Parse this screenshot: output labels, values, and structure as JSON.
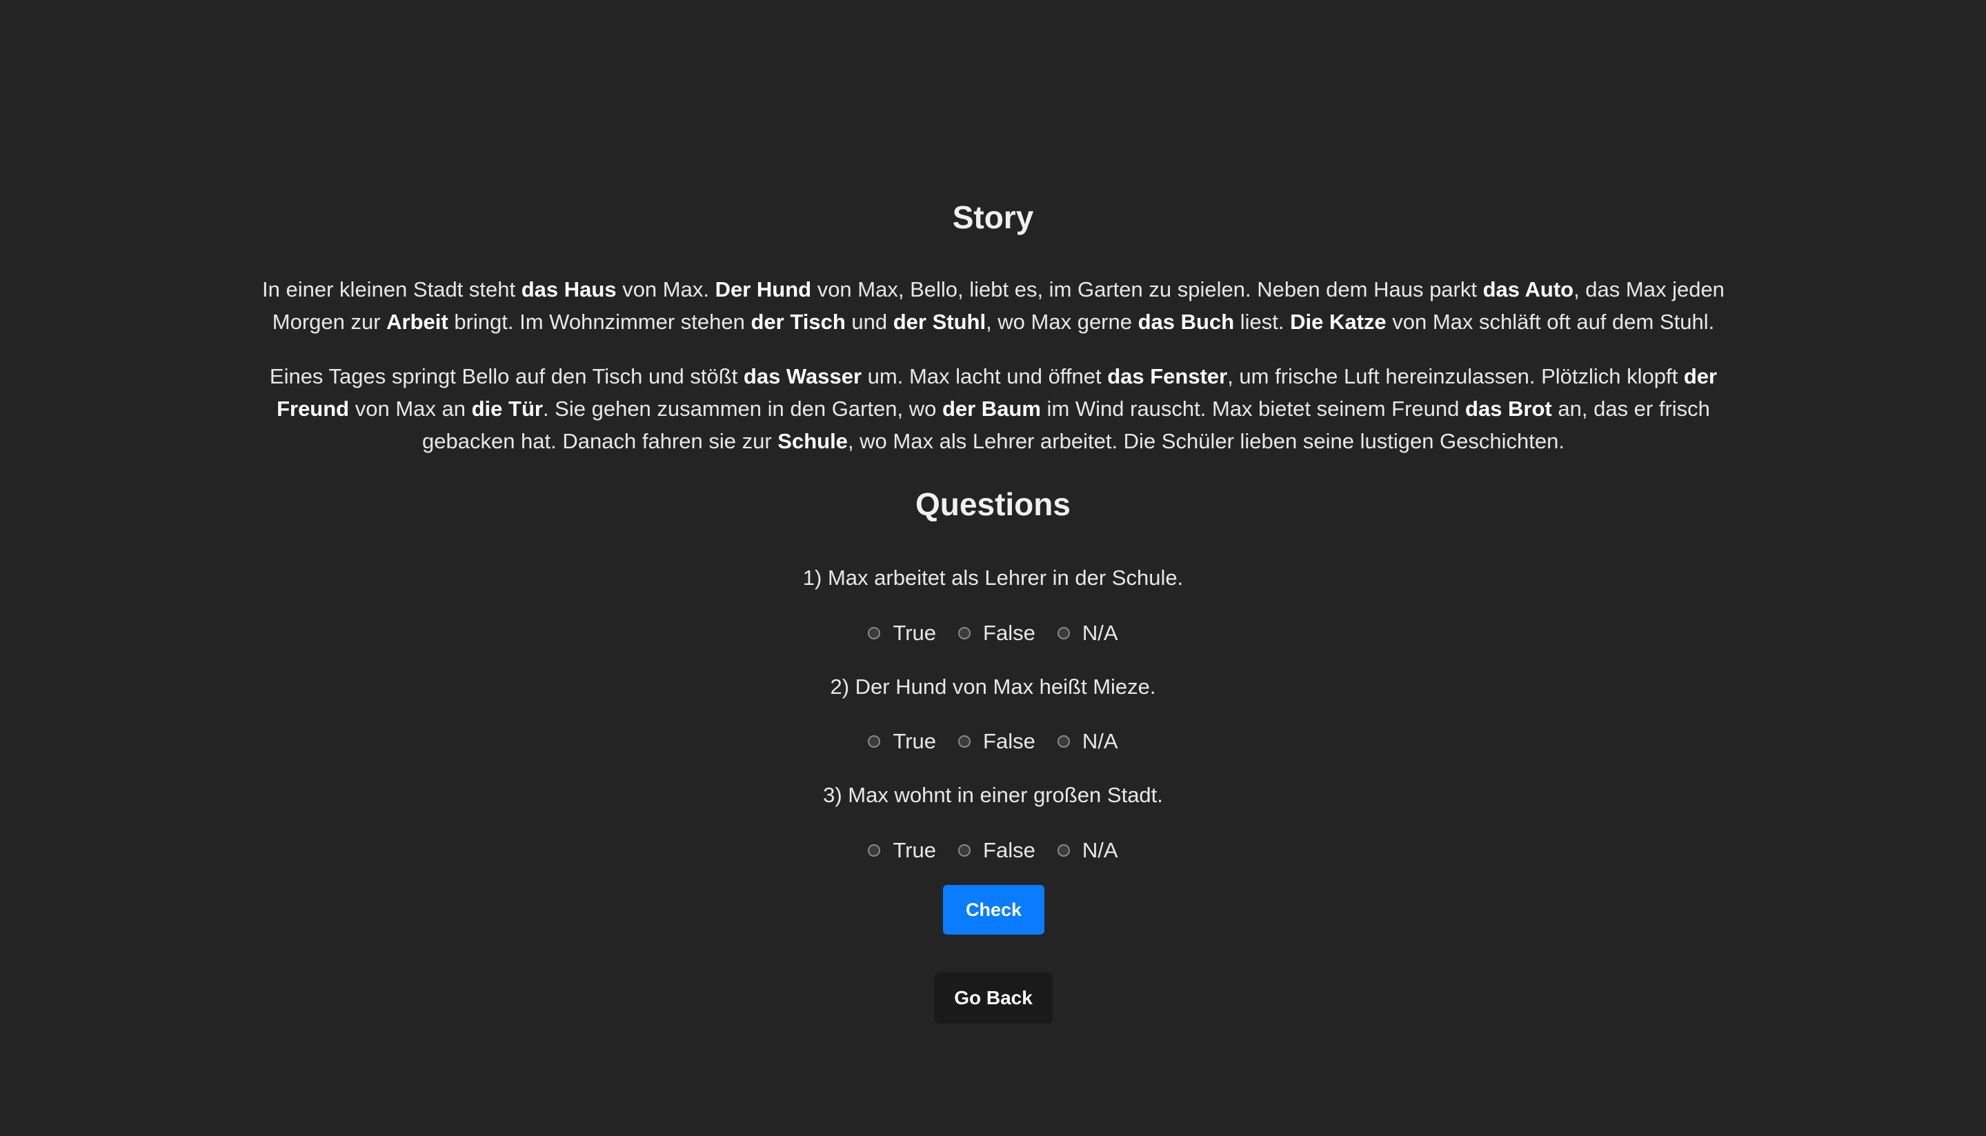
{
  "story": {
    "title": "Story",
    "paragraphs": [
      [
        {
          "t": "In einer kleinen Stadt steht ",
          "b": false
        },
        {
          "t": "das Haus",
          "b": true
        },
        {
          "t": " von Max. ",
          "b": false
        },
        {
          "t": "Der Hund",
          "b": true
        },
        {
          "t": " von Max, Bello, liebt es, im Garten zu spielen. Neben dem Haus parkt ",
          "b": false
        },
        {
          "t": "das Auto",
          "b": true
        },
        {
          "t": ", das Max jeden Morgen zur ",
          "b": false
        },
        {
          "t": "Arbeit",
          "b": true
        },
        {
          "t": " bringt. Im Wohnzimmer stehen ",
          "b": false
        },
        {
          "t": "der Tisch",
          "b": true
        },
        {
          "t": " und ",
          "b": false
        },
        {
          "t": "der Stuhl",
          "b": true
        },
        {
          "t": ", wo Max gerne ",
          "b": false
        },
        {
          "t": "das Buch",
          "b": true
        },
        {
          "t": " liest. ",
          "b": false
        },
        {
          "t": "Die Katze",
          "b": true
        },
        {
          "t": " von Max schläft oft auf dem Stuhl.",
          "b": false
        }
      ],
      [
        {
          "t": "Eines Tages springt Bello auf den Tisch und stößt ",
          "b": false
        },
        {
          "t": "das Wasser",
          "b": true
        },
        {
          "t": " um. Max lacht und öffnet ",
          "b": false
        },
        {
          "t": "das Fenster",
          "b": true
        },
        {
          "t": ", um frische Luft hereinzulassen. Plötzlich klopft ",
          "b": false
        },
        {
          "t": "der Freund",
          "b": true
        },
        {
          "t": " von Max an ",
          "b": false
        },
        {
          "t": "die Tür",
          "b": true
        },
        {
          "t": ". Sie gehen zusammen in den Garten, wo ",
          "b": false
        },
        {
          "t": "der Baum",
          "b": true
        },
        {
          "t": " im Wind rauscht. Max bietet seinem Freund ",
          "b": false
        },
        {
          "t": "das Brot",
          "b": true
        },
        {
          "t": " an, das er frisch gebacken hat. Danach fahren sie zur ",
          "b": false
        },
        {
          "t": "Schule",
          "b": true
        },
        {
          "t": ", wo Max als Lehrer arbeitet. Die Schüler lieben seine lustigen Geschichten.",
          "b": false
        }
      ]
    ]
  },
  "questions": {
    "title": "Questions",
    "items": [
      {
        "text": "1) Max arbeitet als Lehrer in der Schule.",
        "options": [
          "True",
          "False",
          "N/A"
        ]
      },
      {
        "text": "2) Der Hund von Max heißt Mieze.",
        "options": [
          "True",
          "False",
          "N/A"
        ]
      },
      {
        "text": "3) Max wohnt in einer großen Stadt.",
        "options": [
          "True",
          "False",
          "N/A"
        ]
      }
    ]
  },
  "buttons": {
    "check_label": "Check",
    "back_label": "Go Back"
  },
  "colors": {
    "background": "#242424",
    "accent": "#0a7cff",
    "back_button": "#1a1a1a"
  }
}
